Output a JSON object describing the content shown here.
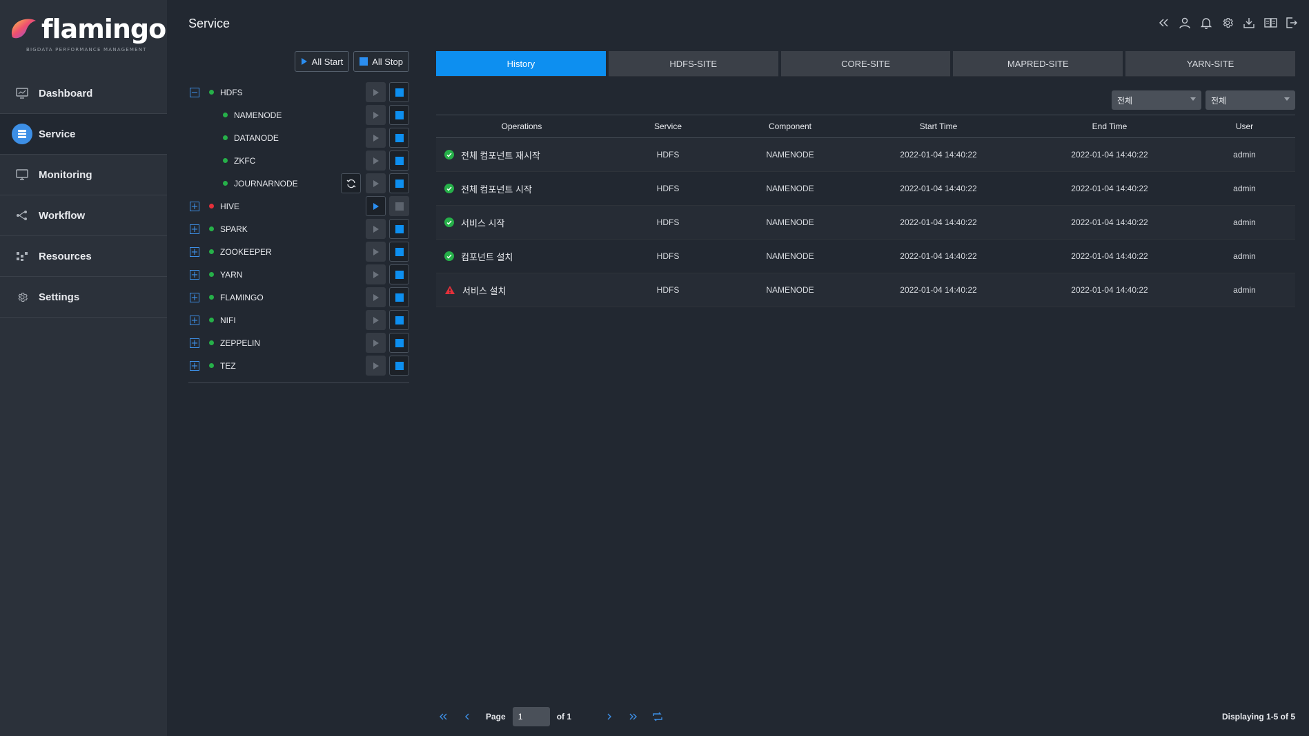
{
  "brand": {
    "name": "flamingo",
    "tagline": "BIGDATA PERFORMANCE MANAGEMENT"
  },
  "sidebar": {
    "items": [
      {
        "label": "Dashboard",
        "icon": "monitor-chart-icon",
        "active": false
      },
      {
        "label": "Service",
        "icon": "service-layers-icon",
        "active": true
      },
      {
        "label": "Monitoring",
        "icon": "monitor-icon",
        "active": false
      },
      {
        "label": "Workflow",
        "icon": "workflow-icon",
        "active": false
      },
      {
        "label": "Resources",
        "icon": "resources-icon",
        "active": false
      },
      {
        "label": "Settings",
        "icon": "gear-icon",
        "active": false
      }
    ]
  },
  "header": {
    "title": "Service",
    "icons": [
      "collapse-icon",
      "user-icon",
      "bell-icon",
      "gear-icon",
      "download-icon",
      "book-icon",
      "logout-icon"
    ]
  },
  "tree": {
    "all_start": "All Start",
    "all_stop": "All Stop",
    "services": [
      {
        "name": "HDFS",
        "status": "green",
        "expanded": true,
        "play_enabled": false,
        "stop_enabled": true,
        "children": [
          {
            "name": "NAMENODE",
            "status": "green"
          },
          {
            "name": "DATANODE",
            "status": "green"
          },
          {
            "name": "ZKFC",
            "status": "green"
          },
          {
            "name": "JOURNARNODE",
            "status": "green",
            "refresh": true
          }
        ]
      },
      {
        "name": "HIVE",
        "status": "red",
        "expanded": false,
        "play_enabled": true,
        "stop_enabled": false
      },
      {
        "name": "SPARK",
        "status": "green",
        "expanded": false,
        "play_enabled": false,
        "stop_enabled": true
      },
      {
        "name": "ZOOKEEPER",
        "status": "green",
        "expanded": false,
        "play_enabled": false,
        "stop_enabled": true
      },
      {
        "name": "YARN",
        "status": "green",
        "expanded": false,
        "play_enabled": false,
        "stop_enabled": true
      },
      {
        "name": "FLAMINGO",
        "status": "green",
        "expanded": false,
        "play_enabled": false,
        "stop_enabled": true
      },
      {
        "name": "NIFI",
        "status": "green",
        "expanded": false,
        "play_enabled": false,
        "stop_enabled": true
      },
      {
        "name": "ZEPPELIN",
        "status": "green",
        "expanded": false,
        "play_enabled": false,
        "stop_enabled": true
      },
      {
        "name": "TEZ",
        "status": "green",
        "expanded": false,
        "play_enabled": false,
        "stop_enabled": true
      }
    ]
  },
  "tabs": [
    {
      "label": "History",
      "active": true
    },
    {
      "label": "HDFS-SITE",
      "active": false
    },
    {
      "label": "CORE-SITE",
      "active": false
    },
    {
      "label": "MAPRED-SITE",
      "active": false
    },
    {
      "label": "YARN-SITE",
      "active": false
    }
  ],
  "filters": [
    {
      "value": "전체"
    },
    {
      "value": "전체"
    }
  ],
  "table": {
    "headers": [
      "Operations",
      "Service",
      "Component",
      "Start Time",
      "End Time",
      "User"
    ],
    "rows": [
      {
        "status": "success",
        "operation": "전체 컴포넌트 재시작",
        "service": "HDFS",
        "component": "NAMENODE",
        "start": "2022-01-04 14:40:22",
        "end": "2022-01-04 14:40:22",
        "user": "admin"
      },
      {
        "status": "success",
        "operation": "전체 컴포넌트 시작",
        "service": "HDFS",
        "component": "NAMENODE",
        "start": "2022-01-04 14:40:22",
        "end": "2022-01-04 14:40:22",
        "user": "admin"
      },
      {
        "status": "success",
        "operation": "서비스 시작",
        "service": "HDFS",
        "component": "NAMENODE",
        "start": "2022-01-04 14:40:22",
        "end": "2022-01-04 14:40:22",
        "user": "admin"
      },
      {
        "status": "success",
        "operation": "컴포넌트 설치",
        "service": "HDFS",
        "component": "NAMENODE",
        "start": "2022-01-04 14:40:22",
        "end": "2022-01-04 14:40:22",
        "user": "admin"
      },
      {
        "status": "warning",
        "operation": "서비스 설치",
        "service": "HDFS",
        "component": "NAMENODE",
        "start": "2022-01-04 14:40:22",
        "end": "2022-01-04 14:40:22",
        "user": "admin"
      }
    ]
  },
  "pagination": {
    "page_label": "Page",
    "page_value": "1",
    "of_label": "of 1",
    "displaying": "Displaying 1-5 of 5"
  },
  "colors": {
    "accent": "#0d8ff0",
    "success": "#26b049",
    "error": "#e5303a",
    "warning": "#e5303a"
  }
}
